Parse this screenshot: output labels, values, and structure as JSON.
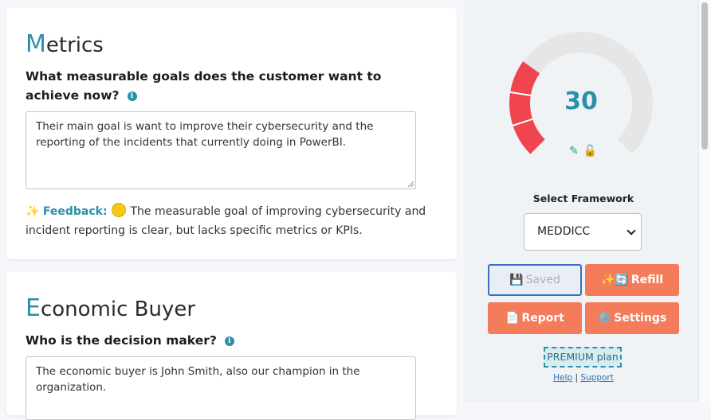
{
  "metrics": {
    "title_initial": "M",
    "title_rest": "etrics",
    "question": "What measurable goals does the customer want to achieve now?",
    "info_icon": "info-icon",
    "answer": "Their main goal is want to improve their cybersecurity and the reporting of the incidents that currently doing in PowerBI.",
    "feedback_label": "Feedback:",
    "feedback_text": "The measurable goal of improving cybersecurity and incident reporting is clear, but lacks specific metrics or KPIs."
  },
  "economic_buyer": {
    "title_initial": "E",
    "title_rest": "conomic Buyer",
    "question": "Who is the decision maker?",
    "answer": "The economic buyer is John Smith, also our champion in the organization."
  },
  "score": {
    "value": "30",
    "fraction": 0.3,
    "colors": {
      "filled": "#f0444f",
      "empty": "#e6e6e6"
    }
  },
  "framework": {
    "label": "Select Framework",
    "selected": "MEDDICC"
  },
  "buttons": {
    "saved": "Saved",
    "refill": "Refill",
    "report": "Report",
    "settings": "Settings"
  },
  "premium_label": "PREMIUM plan",
  "links": {
    "help": "Help",
    "separator": "|",
    "support": "Support"
  },
  "colors": {
    "accent": "#2a8fa8",
    "button": "#f47c5b",
    "saved_border": "#3b6fc8"
  }
}
